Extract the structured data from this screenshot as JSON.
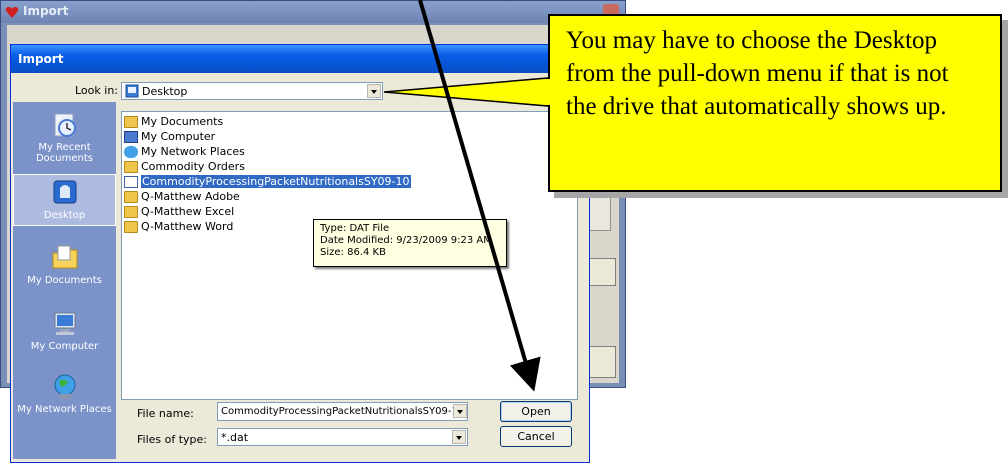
{
  "outer_window": {
    "title": "Import"
  },
  "dialog": {
    "title": "Import",
    "look_in_label": "Look in:",
    "look_in_value": "Desktop",
    "places": [
      {
        "label": "My Recent Documents",
        "icon": "recent-documents-icon"
      },
      {
        "label": "Desktop",
        "icon": "desktop-icon",
        "selected": true
      },
      {
        "label": "My Documents",
        "icon": "my-documents-icon"
      },
      {
        "label": "My Computer",
        "icon": "my-computer-icon"
      },
      {
        "label": "My Network Places",
        "icon": "network-places-icon"
      }
    ],
    "files": [
      {
        "name": "My Documents",
        "icon": "my-documents-icon"
      },
      {
        "name": "My Computer",
        "icon": "my-computer-icon"
      },
      {
        "name": "My Network Places",
        "icon": "network-places-icon"
      },
      {
        "name": "Commodity Orders",
        "icon": "folder-shortcut-icon"
      },
      {
        "name": "CommodityProcessingPacketNutritionalsSY09-10",
        "icon": "dat-file-icon",
        "selected": true
      },
      {
        "name": "Q-Matthew Adobe",
        "icon": "folder-shortcut-icon"
      },
      {
        "name": "Q-Matthew Excel",
        "icon": "folder-shortcut-icon"
      },
      {
        "name": "Q-Matthew Word",
        "icon": "folder-shortcut-icon"
      }
    ],
    "tooltip": {
      "type": "Type: DAT File",
      "modified": "Date Modified: 9/23/2009 9:23 AM",
      "size": "Size: 86.4 KB"
    },
    "file_name_label": "File name:",
    "file_name_value": "CommodityProcessingPacketNutritionalsSY09-1",
    "files_of_type_label": "Files of type:",
    "files_of_type_value": "*.dat",
    "open_label": "Open",
    "cancel_label": "Cancel"
  },
  "callout": {
    "text": "You may have to choose the Desktop from the pull-down menu if that is not the drive that automatically shows up."
  },
  "colors": {
    "callout_bg": "#ffff00",
    "selection": "#316ac5",
    "title_bar": "#0a5fe8"
  }
}
